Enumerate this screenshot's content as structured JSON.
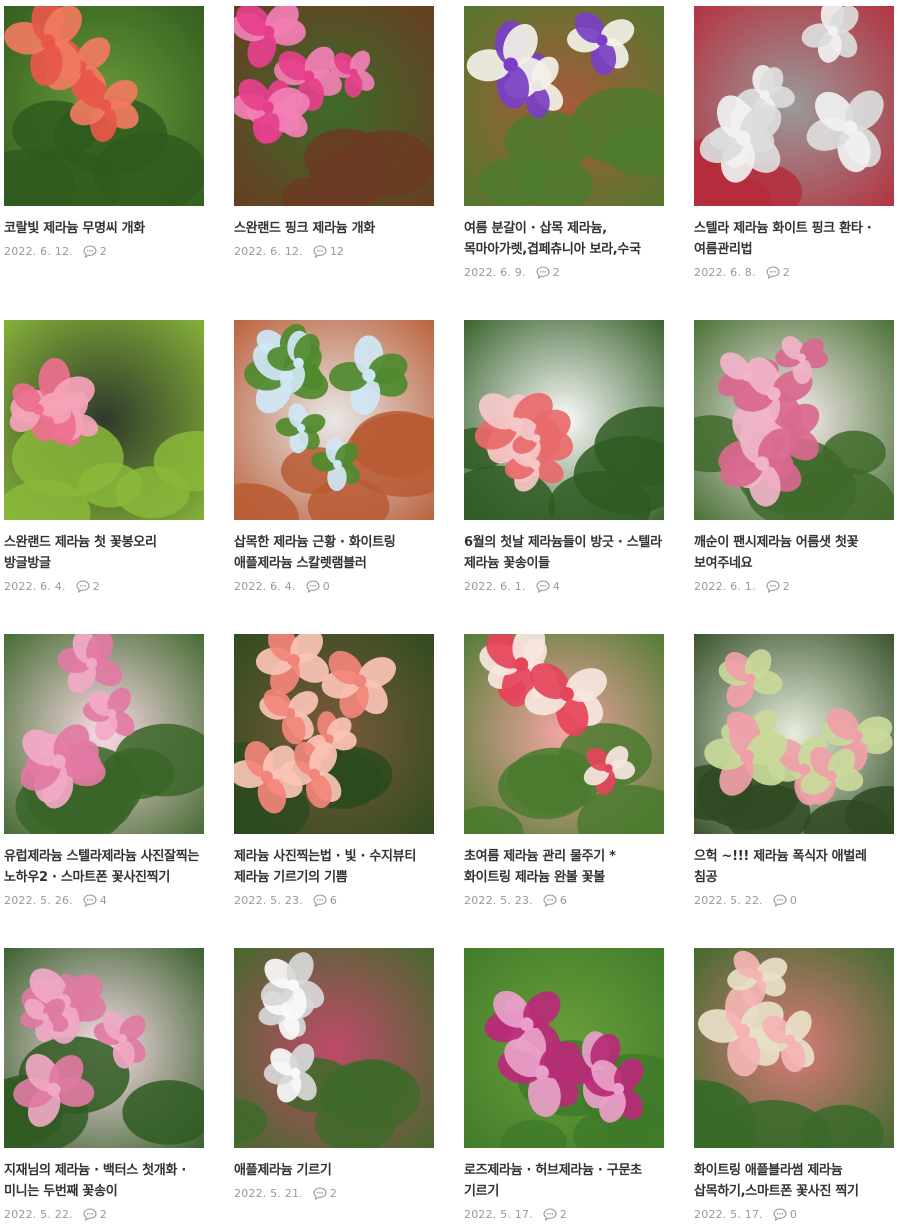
{
  "posts": [
    {
      "title": "코랄빛 제라늄 무명씨 개화",
      "date": "2022. 6. 12.",
      "comments": "2",
      "palette": [
        "#e8574a",
        "#f07a5e",
        "#2f5a1e",
        "#6c9a3a"
      ]
    },
    {
      "title": "스완랜드 핑크 제라늄 개화",
      "date": "2022. 6. 12.",
      "comments": "12",
      "palette": [
        "#e6408c",
        "#f37fb5",
        "#6b3a22",
        "#3d6b2a"
      ]
    },
    {
      "title": "여름 분갈이 · 삽목 제라늄,목마아가렛,겹페츄니아 보라,수국",
      "date": "2022. 6. 9.",
      "comments": "2",
      "palette": [
        "#7a3fc6",
        "#f2f2e8",
        "#4e7a2e",
        "#a85a3a"
      ]
    },
    {
      "title": "스텔라 제라늄 화이트 핑크 환타 · 여름관리법",
      "date": "2022. 6. 8.",
      "comments": "2",
      "palette": [
        "#f1f1f1",
        "#dcdcdc",
        "#b52d3c",
        "#9a9a9a"
      ]
    },
    {
      "title": "스완랜드 제라늄 첫 꽃봉오리 방글방글",
      "date": "2022. 6. 4.",
      "comments": "2",
      "palette": [
        "#ee6f8f",
        "#f5a3b8",
        "#8ab83a",
        "#2f3a2a"
      ]
    },
    {
      "title": "삽목한 제라늄 근황 · 화이트링 애플제라늄 스칼렛램블러",
      "date": "2022. 6. 4.",
      "comments": "0",
      "palette": [
        "#cfe7f5",
        "#4f8a2e",
        "#b85a33",
        "#e8e8e8"
      ]
    },
    {
      "title": "6월의 첫날 제라늄들이 방긋 · 스텔라 제라늄 꽃송이들",
      "date": "2022. 6. 1.",
      "comments": "4",
      "palette": [
        "#f5c8c8",
        "#e86a6a",
        "#2f5a22",
        "#fafafa"
      ]
    },
    {
      "title": "깨순이 팬시제라늄 어름샛 첫꽃 보여주네요",
      "date": "2022. 6. 1.",
      "comments": "2",
      "palette": [
        "#f0b4c8",
        "#d9688e",
        "#3f6a2a",
        "#fbeef2"
      ]
    },
    {
      "title": "유럽제라늄 스텔라제라늄 사진잘찍는 노하우2 · 스마트폰 꽃사진찍기",
      "date": "2022. 5. 26.",
      "comments": "4",
      "palette": [
        "#f2a9c6",
        "#e27aa4",
        "#3a6528",
        "#fbdbe6"
      ]
    },
    {
      "title": "제라늄 사진찍는법 · 빛 · 수지뷰티 제라늄 기르기의 기쁨",
      "date": "2022. 5. 23.",
      "comments": "6",
      "palette": [
        "#f2857a",
        "#fbc3b6",
        "#2c4a1e",
        "#7a5a3a"
      ]
    },
    {
      "title": "초여름 제라늄 관리 물주기 * 화이트링 제라늄 완볼 꽃볼",
      "date": "2022. 5. 23.",
      "comments": "6",
      "palette": [
        "#e5445a",
        "#f7e6e0",
        "#4a7a2e",
        "#f4a5a5"
      ]
    },
    {
      "title": "으헉 ~!!! 제라늄 폭식자 애벌레 침공",
      "date": "2022. 5. 22.",
      "comments": "0",
      "palette": [
        "#f0a0a8",
        "#c9d99a",
        "#2f4a22",
        "#e7eddc"
      ]
    },
    {
      "title": "지재님의 제라늄 · 백터스 첫개화 · 미니는 두번째 꽃송이",
      "date": "2022. 5. 22.",
      "comments": "2",
      "palette": [
        "#f0a8c4",
        "#e07aa2",
        "#2f5a22",
        "#f9dbe8"
      ]
    },
    {
      "title": "애플제라늄 기르기",
      "date": "2022. 5. 21.",
      "comments": "2",
      "palette": [
        "#fafafa",
        "#d8d8d8",
        "#3f6a2a",
        "#c04a6a"
      ]
    },
    {
      "title": "로즈제라늄 · 허브제라늄 · 구문초 기르기",
      "date": "2022. 5. 17.",
      "comments": "2",
      "palette": [
        "#e8a0c8",
        "#b82a78",
        "#3f7a2a",
        "#6aa03a"
      ]
    },
    {
      "title": "화이트링 애플블라썸 제라늄 삽목하기,스마트폰 꽃사진 찍기",
      "date": "2022. 5. 17.",
      "comments": "0",
      "palette": [
        "#f4b4b4",
        "#e8e0c8",
        "#3a6a2a",
        "#d97a7a"
      ]
    }
  ],
  "icons": {
    "comment": "comment-bubble-icon"
  }
}
